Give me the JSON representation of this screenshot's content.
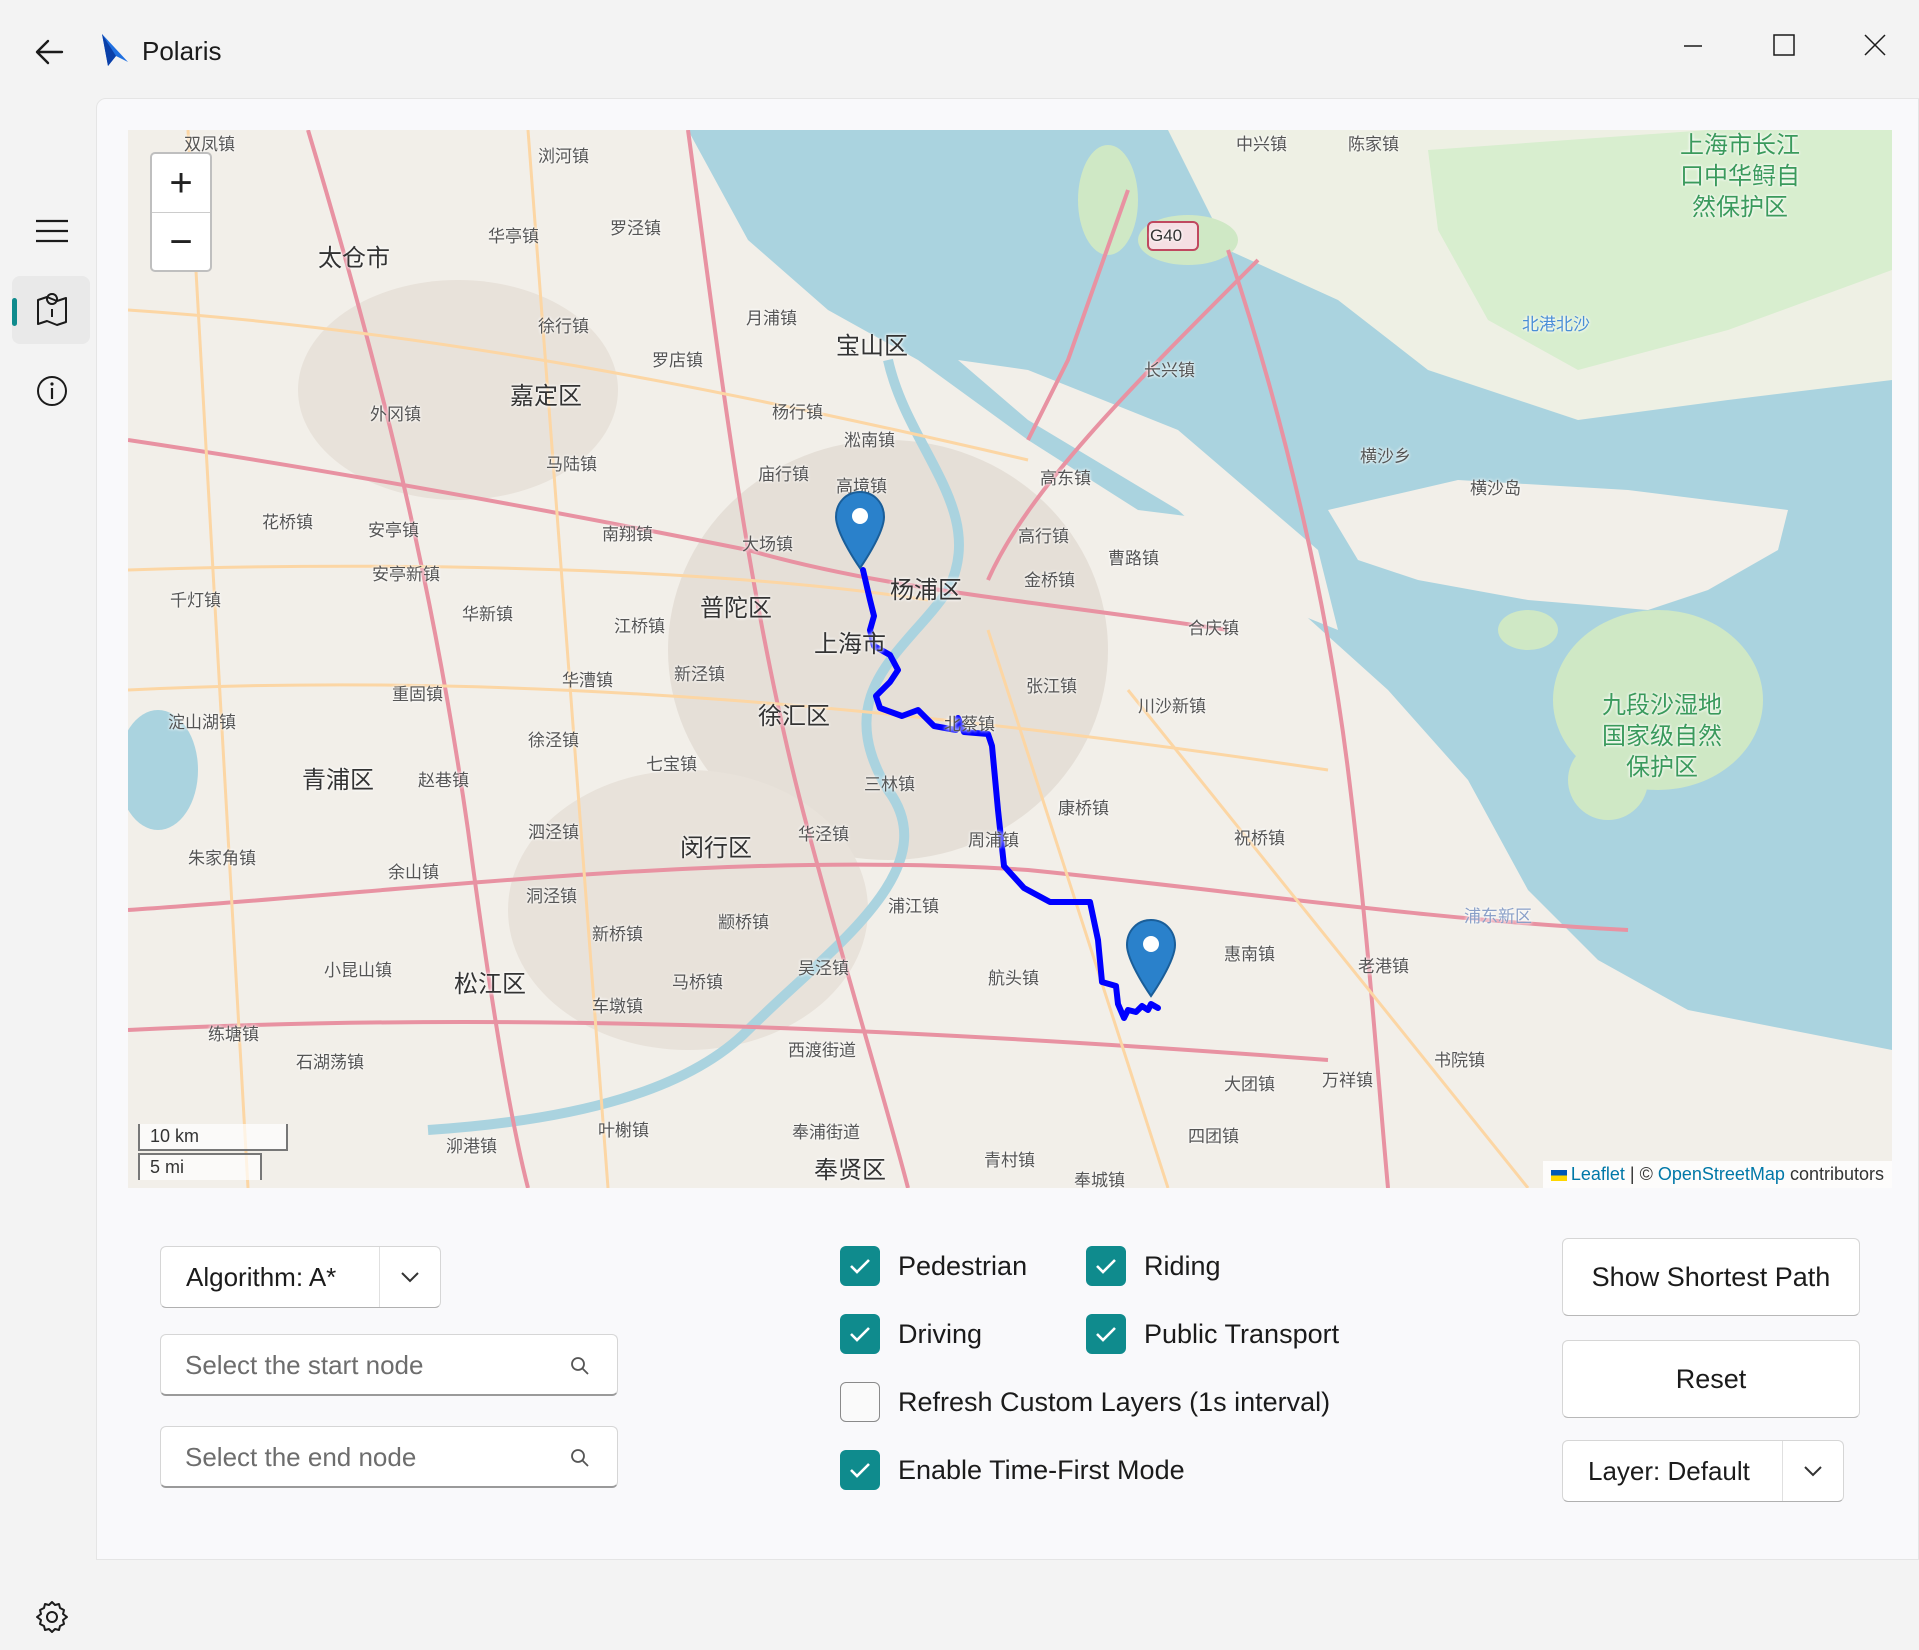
{
  "window": {
    "title": "Polaris",
    "icons": [
      "back-arrow-icon",
      "polaris-logo-icon",
      "minimize-icon",
      "maximize-icon",
      "close-icon"
    ]
  },
  "nav": {
    "items": [
      {
        "name": "menu",
        "icon": "hamburger-menu-icon"
      },
      {
        "name": "map",
        "icon": "map-icon",
        "selected": true
      },
      {
        "name": "info",
        "icon": "info-icon"
      },
      {
        "name": "settings",
        "icon": "gear-icon"
      }
    ]
  },
  "map": {
    "zoom_in": "+",
    "zoom_out": "−",
    "scale_km": "10 km",
    "scale_mi": "5 mi",
    "attribution_leaflet": "Leaflet",
    "attribution_sep": "| ©",
    "attribution_osm": "OpenStreetMap",
    "attribution_tail": "contributors",
    "labels": [
      "双凤镇",
      "浏河镇",
      "太仓市",
      "华亭镇",
      "罗泾镇",
      "宝山区",
      "月浦镇",
      "徐行镇",
      "罗店镇",
      "嘉定区",
      "外冈镇",
      "杨行镇",
      "淞南镇",
      "马陆镇",
      "庙行镇",
      "高境镇",
      "花桥镇",
      "安亭镇",
      "南翔镇",
      "大场镇",
      "杨浦区",
      "高东镇",
      "高行镇",
      "曹路镇",
      "金桥镇",
      "安亭新镇",
      "千灯镇",
      "华新镇",
      "江桥镇",
      "普陀区",
      "上海市",
      "合庆镇",
      "重固镇",
      "华漕镇",
      "新泾镇",
      "张江镇",
      "川沙新镇",
      "淀山湖镇",
      "徐汇区",
      "北蔡镇",
      "青浦区",
      "赵巷镇",
      "徐泾镇",
      "七宝镇",
      "三林镇",
      "康桥镇",
      "朱家角镇",
      "泗泾镇",
      "闵行区",
      "华泾镇",
      "周浦镇",
      "祝桥镇",
      "余山镇",
      "洞泾镇",
      "浦江镇",
      "新桥镇",
      "颛桥镇",
      "惠南镇",
      "老港镇",
      "小昆山镇",
      "松江区",
      "吴泾镇",
      "马桥镇",
      "航头镇",
      "车墩镇",
      "练塘镇",
      "西渡街道",
      "大团镇",
      "万祥镇",
      "书院镇",
      "石湖荡镇",
      "叶榭镇",
      "奉浦街道",
      "泖港镇",
      "奉贤区",
      "青村镇",
      "四团镇",
      "奉城镇",
      "长兴镇",
      "横沙乡",
      "横沙岛",
      "中兴镇",
      "陈家镇",
      "北港北沙",
      "九段沙湿地国家级自然保护区",
      "浦东新区",
      "G40",
      "上海市长江口中华鲟自然保护区"
    ]
  },
  "route": {
    "color": "#0000ff",
    "start_marker": "map-pin-icon",
    "end_marker": "map-pin-icon"
  },
  "controls": {
    "algorithm_label": "Algorithm: A*",
    "start_placeholder": "Select the start node",
    "end_placeholder": "Select the end node",
    "checkboxes": [
      {
        "label": "Pedestrian",
        "checked": true
      },
      {
        "label": "Riding",
        "checked": true
      },
      {
        "label": "Driving",
        "checked": true
      },
      {
        "label": "Public Transport",
        "checked": true
      },
      {
        "label": "Refresh Custom Layers (1s interval)",
        "checked": false
      },
      {
        "label": "Enable Time-First Mode",
        "checked": true
      }
    ],
    "show_shortest_path": "Show Shortest Path",
    "reset": "Reset",
    "layer_label": "Layer: Default"
  },
  "colors": {
    "accent": "#0f8b8d",
    "route": "#0000ff",
    "marker": "#2a81cb",
    "water": "#aad3df",
    "land": "#f2efe9"
  }
}
